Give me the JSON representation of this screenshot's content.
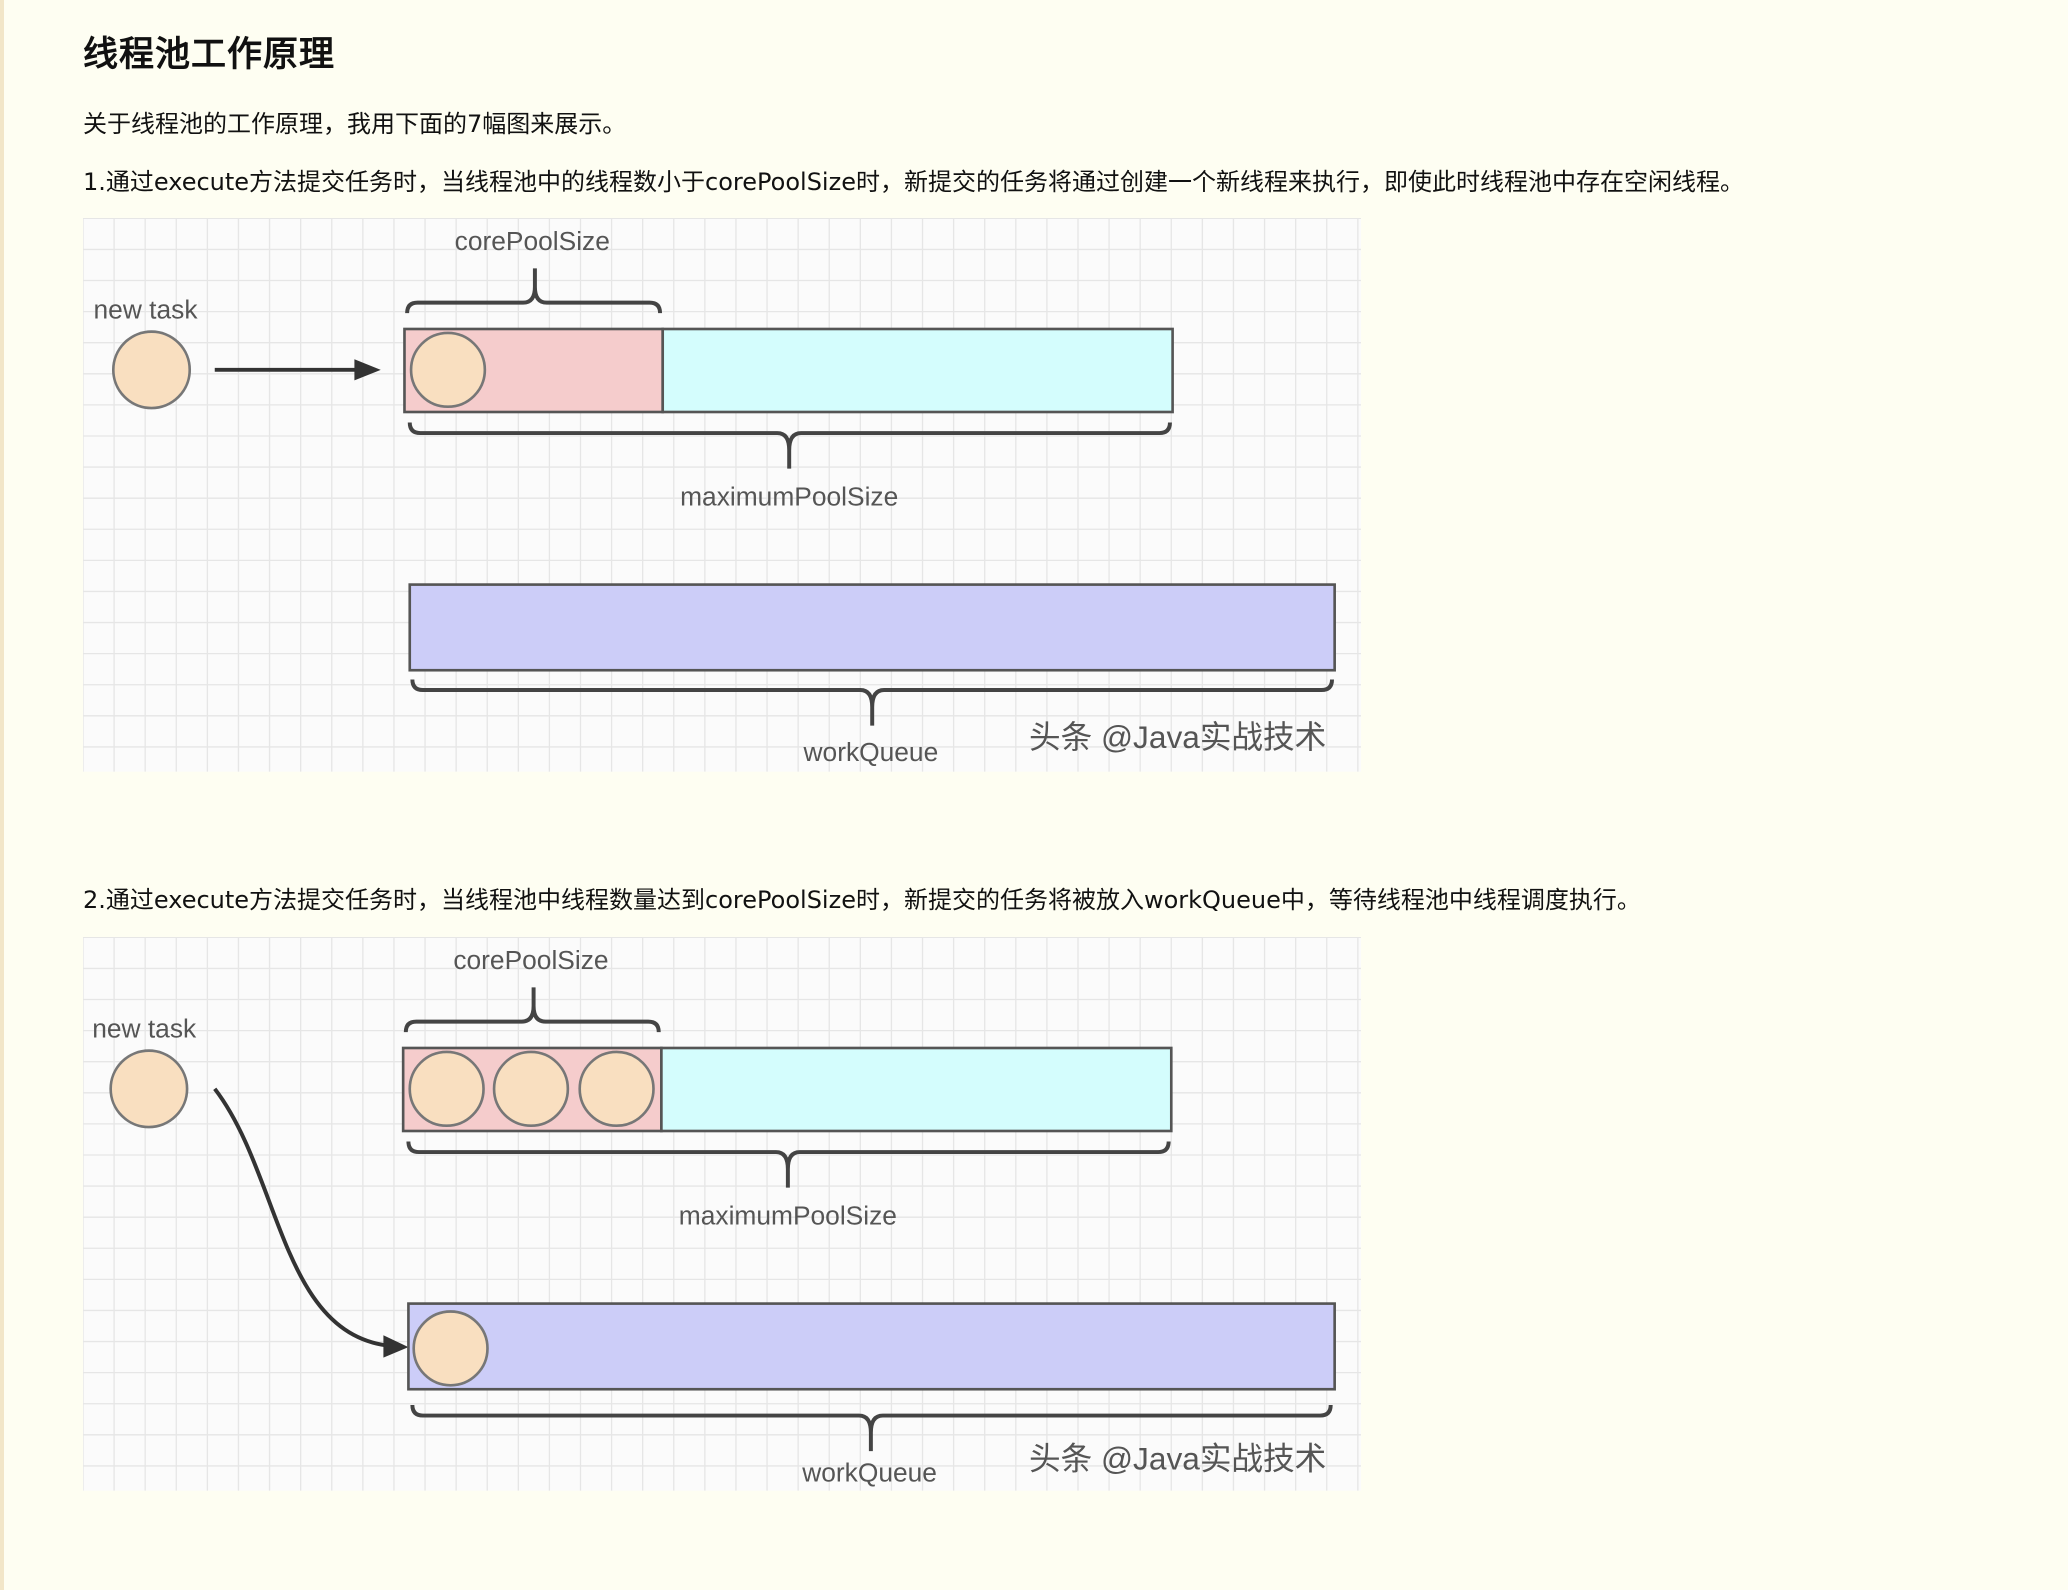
{
  "title": "线程池工作原理",
  "intro": "关于线程池的工作原理，我用下面的7幅图来展示。",
  "step1": "1.通过execute方法提交任务时，当线程池中的线程数小于corePoolSize时，新提交的任务将通过创建一个新线程来执行，即使此时线程池中存在空闲线程。",
  "step2": "2.通过execute方法提交任务时，当线程池中线程数量达到corePoolSize时，新提交的任务将被放入workQueue中，等待线程池中线程调度执行。",
  "figure1": {
    "new_task": "new task",
    "core": "corePoolSize",
    "max": "maximumPoolSize",
    "queue": "workQueue",
    "watermark": "头条 @Java实战技术",
    "core_threads": 1,
    "queued_tasks": 0
  },
  "figure2": {
    "new_task": "new task",
    "core": "corePoolSize",
    "max": "maximumPoolSize",
    "queue": "workQueue",
    "watermark": "头条 @Java实战技术",
    "core_threads": 3,
    "queued_tasks": 1
  },
  "colors": {
    "core": "#f5cccc",
    "max": "#d4fdfd",
    "queue": "#cccdf8",
    "task": "#f9dfc0"
  }
}
